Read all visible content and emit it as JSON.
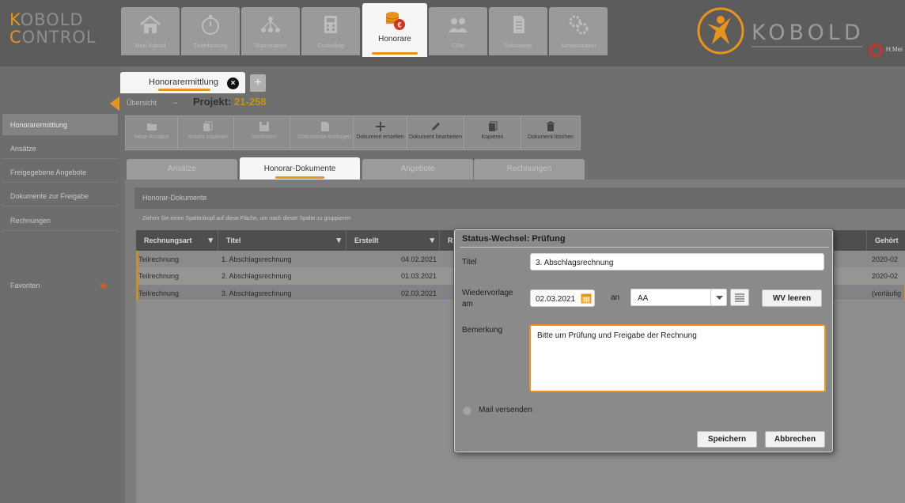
{
  "app": {
    "logo_top_accent": "K",
    "logo_top_rest": "OBOLD",
    "logo_bottom_accent": "C",
    "logo_bottom_rest": "ONTROL",
    "brand_name": "KOBOLD",
    "accent_color": "#e8941a"
  },
  "nav": {
    "tabs": [
      {
        "label": "Mein Kobold",
        "icon": "home-icon"
      },
      {
        "label": "Zeiterfassung",
        "icon": "stopwatch-icon"
      },
      {
        "label": "Stammdaten",
        "icon": "hierarchy-icon"
      },
      {
        "label": "Controlling",
        "icon": "calculator-icon"
      },
      {
        "label": "Honorare",
        "icon": "coins-euro-icon",
        "active": true
      },
      {
        "label": "CRM",
        "icon": "people-icon"
      },
      {
        "label": "Dokumente",
        "icon": "document-icon"
      },
      {
        "label": "Administration",
        "icon": "gears-icon"
      }
    ]
  },
  "user": {
    "label": "H.Mei"
  },
  "sidebar": {
    "items": [
      {
        "label": "Honorarermittlung",
        "active": true
      },
      {
        "label": "Ansätze"
      },
      {
        "label": "Freigegebene Angebote"
      },
      {
        "label": "Dokumente zur Freigabe"
      },
      {
        "label": "Rechnungen"
      }
    ],
    "favorites_label": "Favoriten"
  },
  "doc_tab": {
    "label": "Honorarermittlung"
  },
  "breadcrumb": {
    "overview": "Übersicht",
    "sep": "→",
    "project_prefix": "Projekt:",
    "project_number": "21-258"
  },
  "toolbar": {
    "tools": [
      {
        "label": "Neue Ansätze",
        "icon": "folder-icon"
      },
      {
        "label": "Ansatz kopieren",
        "icon": "copy-icon"
      },
      {
        "label": "Speichern",
        "icon": "save-icon"
      },
      {
        "label": "Dokumente erzeugen",
        "icon": "document-icon"
      },
      {
        "label": "Dokument erstellen",
        "icon": "plus-icon",
        "enabled": true
      },
      {
        "label": "Dokument bearbeiten",
        "icon": "pencil-icon",
        "enabled": true
      },
      {
        "label": "Kopieren",
        "icon": "copy-icon",
        "enabled": true
      },
      {
        "label": "Dokument löschen",
        "icon": "trash-icon",
        "enabled": true
      }
    ]
  },
  "content_tabs": [
    {
      "label": "Ansätze"
    },
    {
      "label": "Honorar-Dokumente",
      "active": true
    },
    {
      "label": "Angebote"
    },
    {
      "label": "Rechnungen"
    }
  ],
  "panel": {
    "title": "Honorar-Dokumente",
    "group_hint": "Ziehen Sie einen Spaltenkopf auf diese Fläche, um nach dieser Spalte zu gruppieren"
  },
  "grid": {
    "columns": [
      "Rechnungsart",
      "Titel",
      "Erstellt",
      "R",
      "Geh"
    ],
    "last_column_label": "Gehört",
    "rows": [
      {
        "art": "Teilrechnung",
        "titel": "1. Abschlagsrechnung",
        "erstellt": "04.02.2021",
        "last": "2020-02"
      },
      {
        "art": "Teilrechnung",
        "titel": "2. Abschlagsrechnung",
        "erstellt": "01.03.2021",
        "last": "2020-02"
      },
      {
        "art": "Teilrechnung",
        "titel": "3. Abschlagsrechnung",
        "erstellt": "02.03.2021",
        "last": "(vorläufig"
      }
    ]
  },
  "dialog": {
    "title": "Status-Wechsel: Prüfung",
    "titel_label": "Titel",
    "titel_value": "3. Abschlagsrechnung",
    "wv_label_line1": "Wiedervorlage",
    "wv_label_line2": "am",
    "date_value": "02.03.2021",
    "an_label": "an",
    "user_value": "AA",
    "wv_clear_label": "WV leeren",
    "remark_label": "Bemerkung",
    "remark_value": "Bitte um Prüfung und Freigabe der Rechnung",
    "mail_label": "Mail versenden",
    "save_label": "Speichern",
    "cancel_label": "Abbrechen"
  }
}
